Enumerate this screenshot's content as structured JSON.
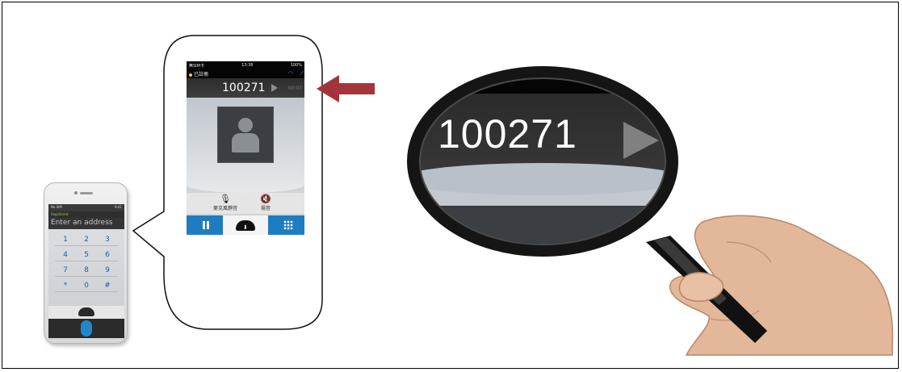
{
  "small_phone": {
    "status_left": "No SIM",
    "status_time": "9:41",
    "registered": "Registered",
    "address_placeholder": "Enter an address",
    "keys": [
      "1",
      "2",
      "3",
      "4",
      "5",
      "6",
      "7",
      "8",
      "9",
      "*",
      "0",
      "#"
    ]
  },
  "call_screen": {
    "status_carrier": "無SIM卡",
    "status_time": "13:36",
    "status_battery": "100%",
    "registration": "已註冊",
    "number": "100271",
    "timer": "00:07",
    "actions": [
      {
        "label": "麥克風靜音",
        "icon": "microphone-icon"
      },
      {
        "label": "揚音",
        "icon": "speaker-mute-icon"
      }
    ]
  },
  "magnified": {
    "number": "100271"
  },
  "colors": {
    "arrow": "#a3353a",
    "accent_blue": "#1f7cc0",
    "header_dark": "#2d2d2d",
    "registered_dot": "#e8d23a"
  }
}
